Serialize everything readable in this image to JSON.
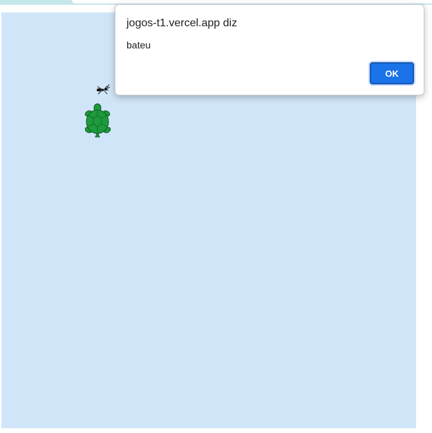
{
  "dialog": {
    "title": "jogos-t1.vercel.app diz",
    "message": "bateu",
    "ok_label": "OK"
  },
  "game": {
    "sprites": [
      "ant-icon",
      "turtle-icon"
    ]
  },
  "colors": {
    "canvas_bg": "#d0e5f8",
    "ok_button": "#1a73e8",
    "turtle": "#1e9a3c",
    "browser_chrome": "#c5e7ea"
  }
}
